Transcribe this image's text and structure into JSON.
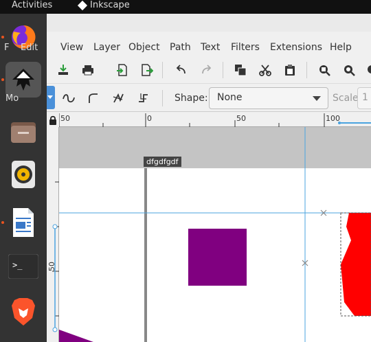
{
  "topbar": {
    "activities": "Activities",
    "app_name": "Inkscape"
  },
  "dock": {
    "items": [
      {
        "name": "firefox",
        "label": "Firefox"
      },
      {
        "name": "inkscape",
        "label": "Inkscape"
      },
      {
        "name": "files",
        "label": "Files"
      },
      {
        "name": "rhythmbox",
        "label": "Rhythmbox"
      },
      {
        "name": "libreoffice-writer",
        "label": "LibreOffice Writer"
      },
      {
        "name": "terminal",
        "label": "Terminal"
      },
      {
        "name": "brave",
        "label": "Brave"
      }
    ],
    "overlay_fragments": [
      "F",
      "Edit",
      "Mo"
    ]
  },
  "menubar": {
    "items": [
      "View",
      "Layer",
      "Object",
      "Path",
      "Text",
      "Filters",
      "Extensions",
      "Help"
    ]
  },
  "toolbar2": {
    "shape_label": "Shape:",
    "shape_value": "None",
    "scale_label": "Scale:",
    "scale_value": "1"
  },
  "rulers": {
    "h_ticks": [
      "50",
      "0",
      "50",
      "100"
    ],
    "v_ticks": [
      "50"
    ]
  },
  "canvas": {
    "page_label": "dfgdfgdf",
    "colors": {
      "square": "#800080",
      "red_shape": "#ff0000",
      "guide": "#4aa3df",
      "canvas_bg": "#c4c4c4"
    }
  }
}
